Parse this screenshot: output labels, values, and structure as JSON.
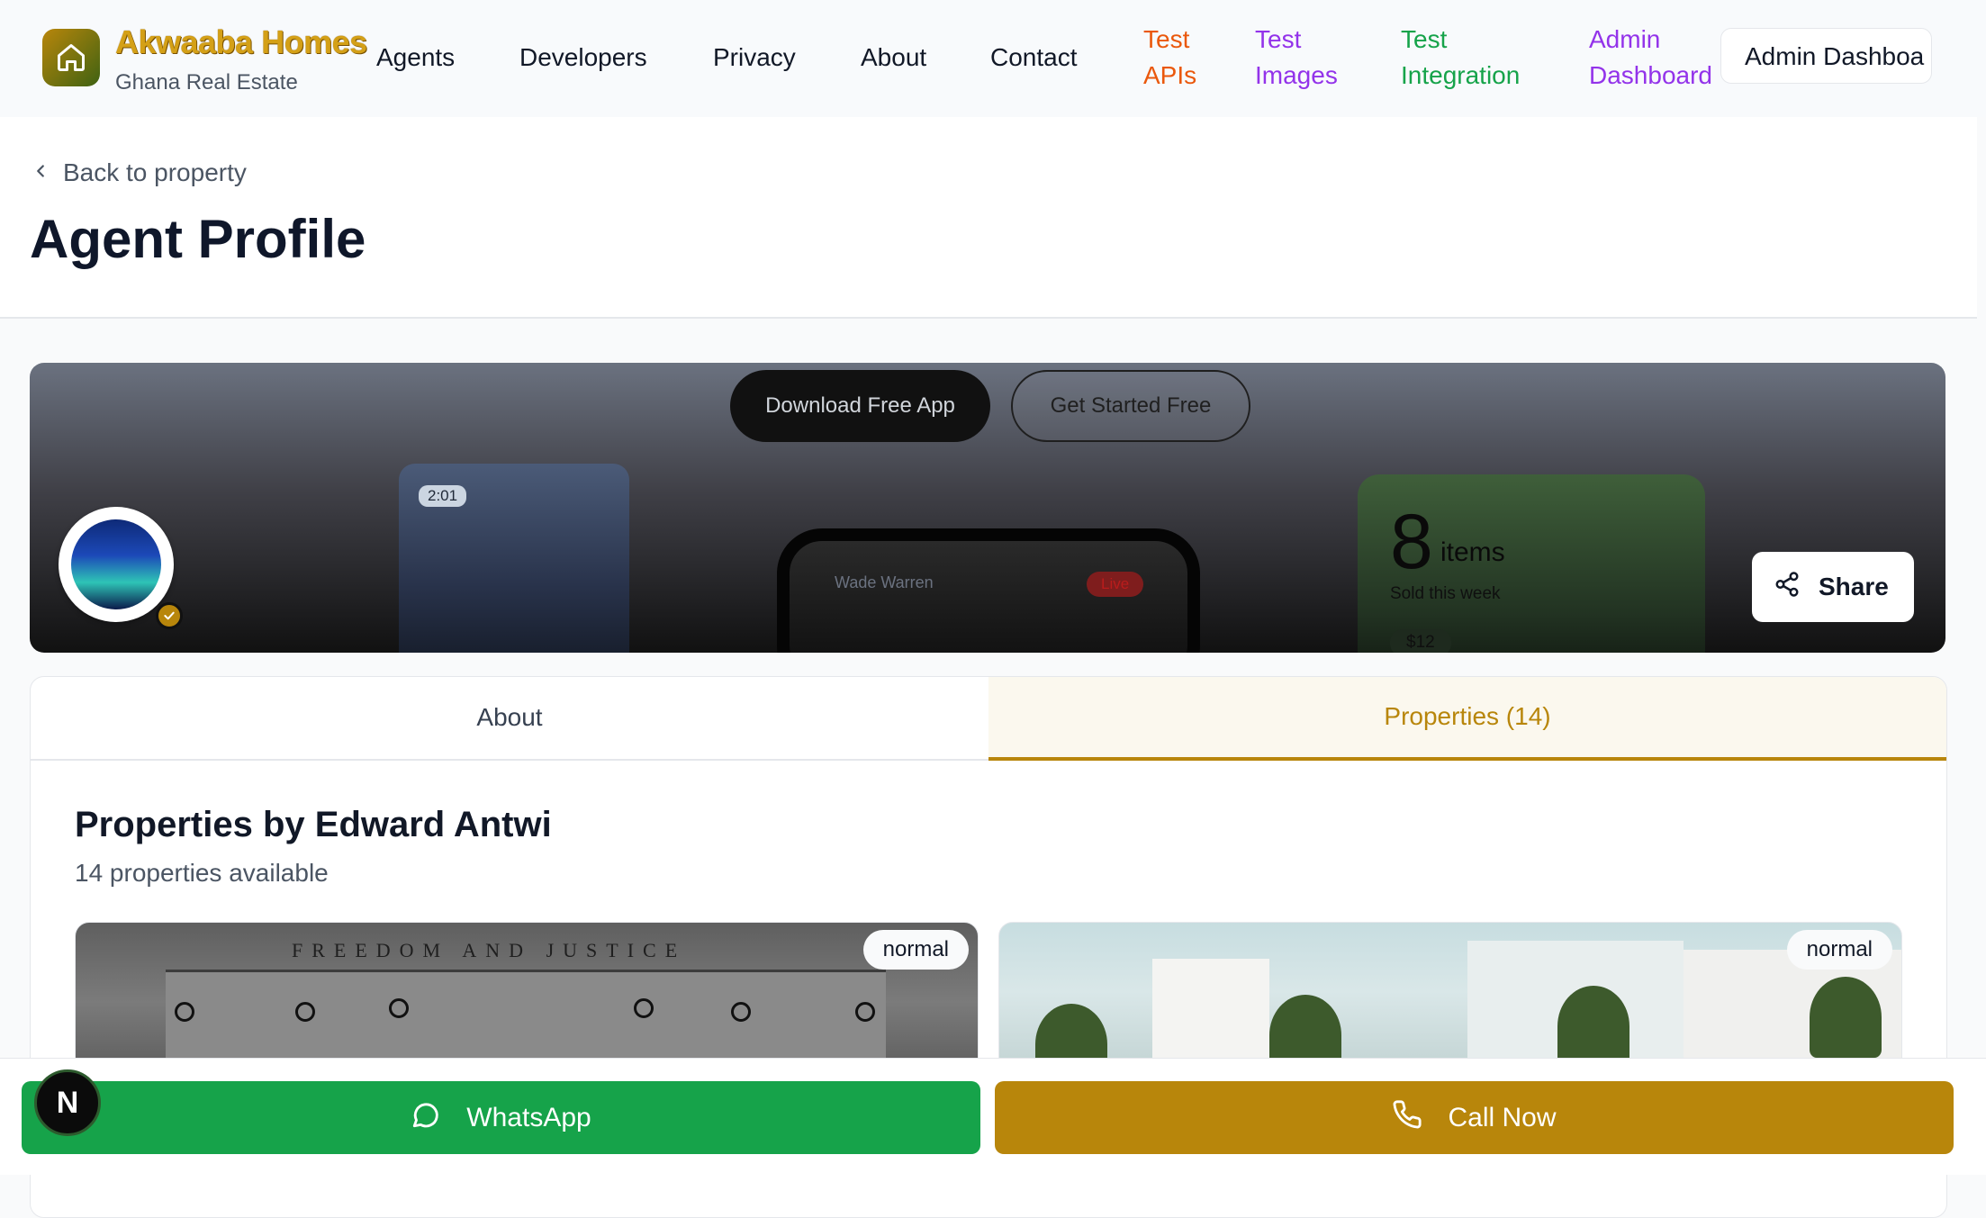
{
  "header": {
    "brand_name": "Akwaaba Homes",
    "brand_subtitle": "Ghana Real Estate",
    "nav": [
      {
        "label": "Agents"
      },
      {
        "label": "Developers"
      },
      {
        "label": "Privacy"
      },
      {
        "label": "About"
      },
      {
        "label": "Contact"
      },
      {
        "label": "Test APIs",
        "color": "#ea580c"
      },
      {
        "label": "Test Images",
        "color": "#9333ea"
      },
      {
        "label": "Test Integration",
        "color": "#16a34a"
      },
      {
        "label": "Admin Dashboard",
        "color": "#9333ea"
      }
    ],
    "admin_button": "Admin Dashboa"
  },
  "page": {
    "back_label": "Back to property",
    "title": "Agent Profile"
  },
  "banner": {
    "download_label": "Download Free App",
    "get_started_label": "Get Started Free",
    "mock_time": "2:01",
    "mock_name": "Wade Warren",
    "mock_live": "Live",
    "mock_count": "8",
    "mock_items": "items",
    "mock_sold": "Sold this week",
    "mock_price": "$12",
    "share_label": "Share"
  },
  "tabs": {
    "about": "About",
    "properties": "Properties (14)"
  },
  "properties": {
    "heading": "Properties by Edward Antwi",
    "count_text": "14 properties available",
    "cards": [
      {
        "badge": "normal",
        "caption": "FREEDOM  AND  JUSTICE"
      },
      {
        "badge": "normal"
      }
    ]
  },
  "bottom_bar": {
    "whatsapp_label": "WhatsApp",
    "call_label": "Call Now",
    "dev_badge": "N"
  },
  "colors": {
    "gold": "#b8860b",
    "whatsapp_green": "#16a34a",
    "test_apis": "#ea580c",
    "test_images": "#9333ea",
    "test_integration": "#16a34a"
  }
}
